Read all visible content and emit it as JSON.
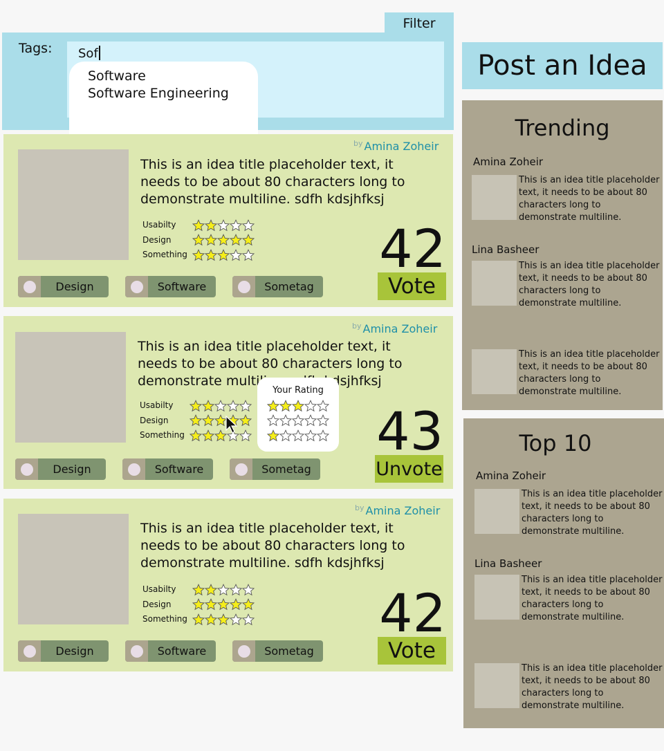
{
  "filter": {
    "tab_label": "Filter",
    "tags_label": "Tags:",
    "input_value": "Sof",
    "suggestions": [
      "Software",
      "Software Engineering"
    ]
  },
  "ideas": [
    {
      "by": "by",
      "author": "Amina Zoheir",
      "title": "This is an idea title placeholder text, it needs to be about 80 characters long to demonstrate multiline. sdfh kdsjhfksj",
      "ratings": [
        {
          "label": "Usabilty",
          "stars": 2
        },
        {
          "label": "Design",
          "stars": 5
        },
        {
          "label": "Something",
          "stars": 3
        }
      ],
      "score": "42",
      "vote_label": "Vote",
      "tags": [
        "Design",
        "Software",
        "Sometag"
      ]
    },
    {
      "by": "by",
      "author": "Amina Zoheir",
      "title": "This is an idea title placeholder text, it needs to be about 80 characters long to demonstrate multiline. sdfh kdsjhfksj",
      "ratings": [
        {
          "label": "Usabilty",
          "stars": 2
        },
        {
          "label": "Design",
          "stars": 5
        },
        {
          "label": "Something",
          "stars": 3
        }
      ],
      "score": "43",
      "vote_label": "Unvote",
      "tags": [
        "Design",
        "Software",
        "Sometag"
      ],
      "your_rating": {
        "title": "Your Rating",
        "stars": [
          3,
          0,
          1
        ]
      }
    },
    {
      "by": "by",
      "author": "Amina Zoheir",
      "title": "This is an idea title placeholder text, it needs to be about 80 characters long to demonstrate multiline. sdfh kdsjhfksj",
      "ratings": [
        {
          "label": "Usabilty",
          "stars": 2
        },
        {
          "label": "Design",
          "stars": 5
        },
        {
          "label": "Something",
          "stars": 3
        }
      ],
      "score": "42",
      "vote_label": "Vote",
      "tags": [
        "Design",
        "Software",
        "Sometag"
      ]
    }
  ],
  "sidebar": {
    "post_idea_label": "Post an Idea",
    "trending": {
      "title": "Trending",
      "items": [
        {
          "author": "Amina Zoheir",
          "text": "This is an idea title placeholder text, it needs to be about 80 characters long to demonstrate multiline."
        },
        {
          "author": "Lina Basheer",
          "text": "This is an idea title placeholder text, it needs to be about 80 characters long to demonstrate multiline."
        },
        {
          "author": "",
          "text": "This is an idea title placeholder text, it needs to be about 80 characters long to demonstrate multiline."
        }
      ]
    },
    "top10": {
      "title": "Top 10",
      "items": [
        {
          "author": "Amina Zoheir",
          "text": "This is an idea title placeholder text, it needs to be about 80 characters long to demonstrate multiline."
        },
        {
          "author": "Lina Basheer",
          "text": "This is an idea title placeholder text, it needs to be about 80 characters long to demonstrate multiline."
        },
        {
          "author": "",
          "text": "This is an idea title placeholder text, it needs to be about 80 characters long to demonstrate multiline."
        }
      ]
    }
  },
  "colors": {
    "star_filled": "#f5ee1a",
    "star_empty": "#ffffff",
    "accent_blue": "#aadde9",
    "vote_green": "#a8c43a"
  }
}
